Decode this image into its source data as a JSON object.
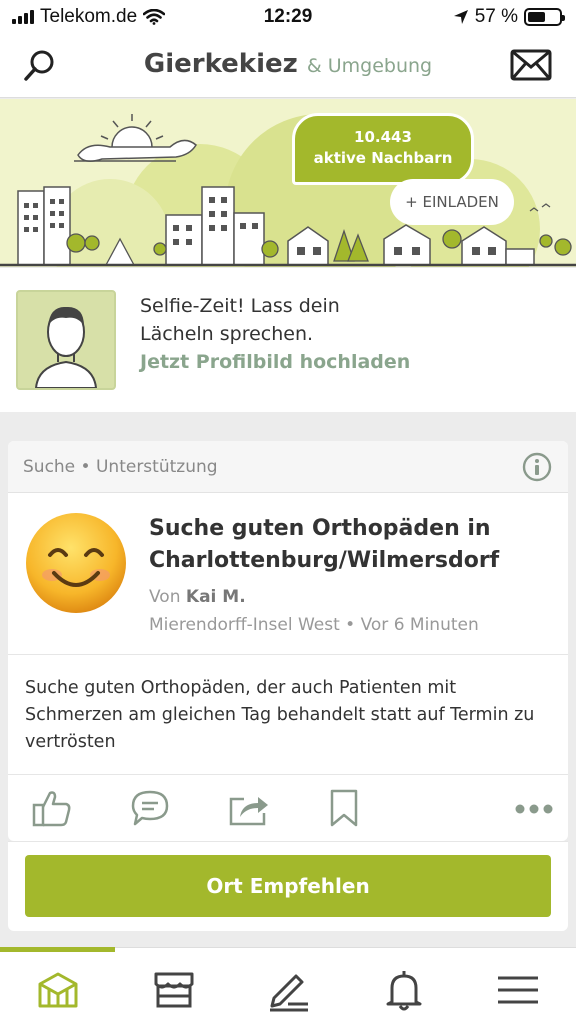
{
  "status_bar": {
    "carrier": "Telekom.de",
    "time": "12:29",
    "battery": "57 %",
    "battery_level": 0.57
  },
  "header": {
    "title": "Gierkekiez",
    "subtitle": "& Umgebung",
    "left_icon": "search-icon",
    "right_icon": "mail-icon"
  },
  "banner": {
    "count": "10.443",
    "count_label": "aktive Nachbarn",
    "invite_label": "+ EINLADEN"
  },
  "profile_prompt": {
    "text": "Selfie-Zeit! Lass dein Lächeln sprechen.",
    "link": "Jetzt Profilbild hochladen"
  },
  "post": {
    "category": "Suche • Unterstützung",
    "title": "Suche guten Orthopäden in Charlottenburg/Wilmersdorf",
    "author_prefix": "Von",
    "author": "Kai M.",
    "location": "Mierendorff-Insel West • Vor 6 Minuten",
    "body": "Suche guten Orthopäden, der auch Patienten mit Schmerzen am gleichen Tag behandelt statt auf Termin zu vertrösten",
    "actions": [
      "like-icon",
      "comment-icon",
      "share-icon",
      "bookmark-icon",
      "more-icon"
    ],
    "recommend_label": "Ort Empfehlen"
  },
  "bottom_nav": {
    "items": [
      "home-icon",
      "marketplace-icon",
      "write-icon",
      "notifications-icon",
      "menu-icon"
    ],
    "active_index": 0
  },
  "colors": {
    "accent": "#a3b82c",
    "muted_green": "#8aa58d",
    "banner_bg": "#f1f4cc"
  }
}
